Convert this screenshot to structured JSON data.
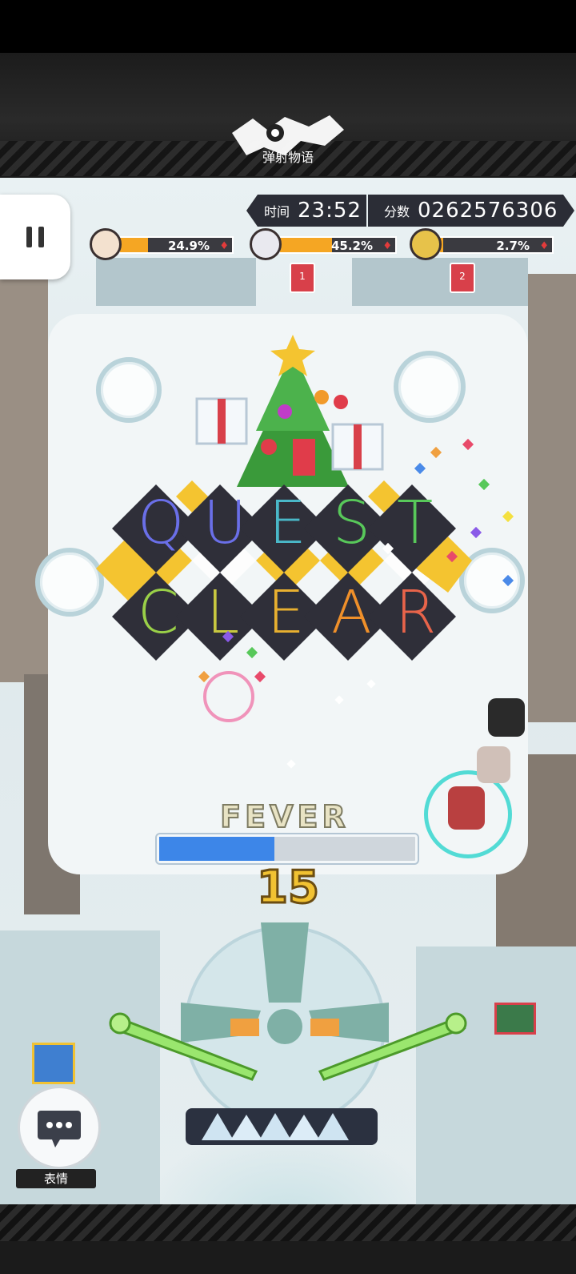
{
  "app": {
    "logo_text": "弹射物语"
  },
  "hud": {
    "time_label": "时间",
    "time_value": "23:52",
    "score_label": "分数",
    "score_value": "0262576306"
  },
  "players": [
    {
      "percent": "24.9%",
      "fill": 0.249
    },
    {
      "percent": "45.2%",
      "fill": 0.452
    },
    {
      "percent": "2.7%",
      "fill": 0.027
    }
  ],
  "flags": [
    {
      "label": "1"
    },
    {
      "label": "2"
    }
  ],
  "banner": {
    "line1": [
      "Q",
      "U",
      "E",
      "S",
      "T"
    ],
    "line2": [
      "C",
      "L",
      "E",
      "A",
      "R"
    ]
  },
  "fever": {
    "label": "FEVER",
    "progress": 0.45,
    "count": "15"
  },
  "emote": {
    "label": "表情"
  },
  "colors": {
    "accent_orange": "#f5a623",
    "fever_blue": "#3d86e8",
    "banner_dark": "#2f2f39",
    "banner_yellow": "#f4c430",
    "hud_dark": "#2b2d36"
  },
  "icons": [
    "pause-icon",
    "chat-bubble-icon",
    "heart-diamond-icon",
    "flag-icon",
    "christmas-tree-icon",
    "gift-icon"
  ]
}
